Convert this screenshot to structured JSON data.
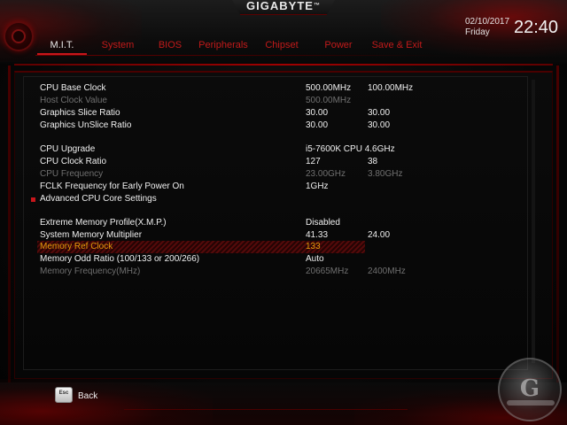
{
  "header": {
    "brand": "GIGABYTE",
    "brand_mark": "™",
    "date": "02/10/2017",
    "day": "Friday",
    "time": "22:40"
  },
  "nav": {
    "tabs": [
      {
        "label": "M.I.T.",
        "active": true
      },
      {
        "label": "System",
        "active": false
      },
      {
        "label": "BIOS",
        "active": false
      },
      {
        "label": "Peripherals",
        "active": false
      },
      {
        "label": "Chipset",
        "active": false
      },
      {
        "label": "Power",
        "active": false
      },
      {
        "label": "Save & Exit",
        "active": false
      }
    ]
  },
  "settings": {
    "rows": [
      {
        "label": "CPU Base Clock",
        "value1": "500.00MHz",
        "value2": "100.00MHz",
        "state": "normal"
      },
      {
        "label": "Host Clock Value",
        "value1": "500.00MHz",
        "value2": "",
        "state": "dim"
      },
      {
        "label": "Graphics Slice Ratio",
        "value1": "30.00",
        "value2": "30.00",
        "state": "normal"
      },
      {
        "label": "Graphics UnSlice Ratio",
        "value1": "30.00",
        "value2": "30.00",
        "state": "normal"
      },
      {
        "label": "CPU Upgrade",
        "value1": "i5-7600K CPU 4.6GHz",
        "value2": "",
        "state": "normal"
      },
      {
        "label": "CPU Clock Ratio",
        "value1": "127",
        "value2": "38",
        "state": "normal"
      },
      {
        "label": "CPU Frequency",
        "value1": "23.00GHz",
        "value2": "3.80GHz",
        "state": "dim"
      },
      {
        "label": "FCLK Frequency for Early Power On",
        "value1": "1GHz",
        "value2": "",
        "state": "normal"
      },
      {
        "label": "Advanced CPU Core Settings",
        "value1": "",
        "value2": "",
        "state": "normal",
        "submenu": true
      },
      {
        "label": "Extreme Memory Profile(X.M.P.)",
        "value1": "Disabled",
        "value2": "",
        "state": "normal"
      },
      {
        "label": "System Memory Multiplier",
        "value1": "41.33",
        "value2": "24.00",
        "state": "normal"
      },
      {
        "label": "Memory Ref Clock",
        "value1": "133",
        "value2": "",
        "state": "selected"
      },
      {
        "label": "Memory Odd Ratio (100/133 or 200/266)",
        "value1": "Auto",
        "value2": "",
        "state": "normal"
      },
      {
        "label": "Memory Frequency(MHz)",
        "value1": "20665MHz",
        "value2": "2400MHz",
        "state": "dim"
      }
    ]
  },
  "footer": {
    "esc_key": "Esc",
    "back_label": "Back"
  },
  "colors": {
    "accent_red": "#c8161b",
    "selected_text": "#e29a0c",
    "dim_text": "#707070",
    "normal_text": "#f0f0f0"
  },
  "icons": {
    "logo": "gigabyte-emblem-icon",
    "submenu_bullet": "red-square-bullet-icon",
    "watermark": "site-watermark-logo"
  }
}
